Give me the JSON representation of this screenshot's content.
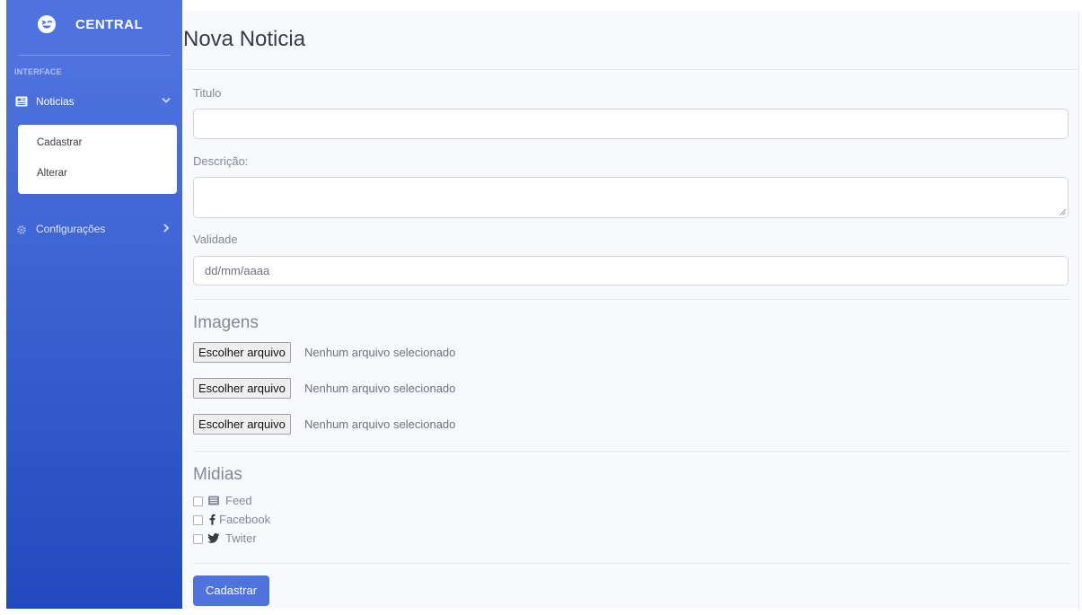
{
  "sidebar": {
    "brand": "CENTRAL",
    "heading": "INTERFACE",
    "noticias": {
      "label": "Noticias",
      "items": [
        {
          "label": "Cadastrar"
        },
        {
          "label": "Alterar"
        }
      ]
    },
    "configuracoes": {
      "label": "Configurações"
    }
  },
  "page": {
    "title": "Nova Noticia"
  },
  "form": {
    "titulo": {
      "label": "Titulo",
      "value": ""
    },
    "descricao": {
      "label": "Descrição:",
      "value": ""
    },
    "validade": {
      "label": "Validade",
      "placeholder": "dd/mm/aaaa"
    },
    "imagens": {
      "title": "Imagens",
      "inputs": [
        {
          "button": "Escolher arquivo",
          "status": "Nenhum arquivo selecionado"
        },
        {
          "button": "Escolher arquivo",
          "status": "Nenhum arquivo selecionado"
        },
        {
          "button": "Escolher arquivo",
          "status": "Nenhum arquivo selecionado"
        }
      ]
    },
    "midias": {
      "title": "Midias",
      "options": [
        {
          "label": "Feed",
          "icon": "newspaper-icon",
          "checked": false
        },
        {
          "label": "Facebook",
          "icon": "facebook-icon",
          "checked": false
        },
        {
          "label": "Twiter",
          "icon": "twitter-icon",
          "checked": false
        }
      ]
    },
    "submit_label": "Cadastrar"
  },
  "colors": {
    "primary": "#4e73df",
    "sidebar_gradient_end": "#224abe",
    "content_bg": "#f8f9fc",
    "text_muted": "#858796"
  }
}
